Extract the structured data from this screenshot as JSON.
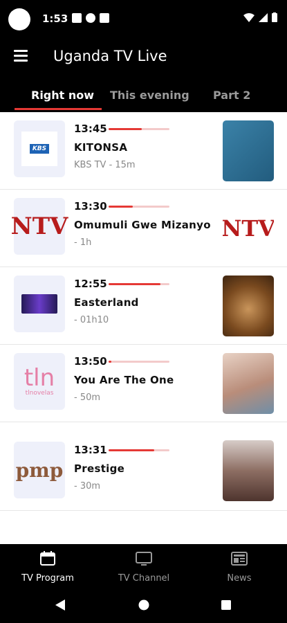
{
  "status": {
    "time": "1:53"
  },
  "app": {
    "title": "Uganda TV Live"
  },
  "tabs": [
    {
      "label": "Right now",
      "active": true
    },
    {
      "label": "This evening",
      "active": false
    },
    {
      "label": "Part 2",
      "active": false
    }
  ],
  "programs": [
    {
      "time": "13:45",
      "title": "KITONSA",
      "subtitle": "KBS TV - 15m",
      "progress": 0.55,
      "channel_logo": "KBS",
      "thumb_color": "#2f6f96"
    },
    {
      "time": "13:30",
      "title": "Omumuli Gwe Mizanyo",
      "subtitle": " - 1h",
      "progress": 0.4,
      "channel_logo": "NTV",
      "thumb_color": "#ffffff"
    },
    {
      "time": "12:55",
      "title": "Easterland",
      "subtitle": " - 01h10",
      "progress": 0.85,
      "channel_logo": "",
      "thumb_color": "#7a4a1f"
    },
    {
      "time": "13:50",
      "title": "You Are The One",
      "subtitle": " - 50m",
      "progress": 0.05,
      "channel_logo": "tln",
      "channel_sub": "tlnovelas",
      "thumb_color": "#c9a394"
    },
    {
      "time": "13:31",
      "title": "Prestige",
      "subtitle": " - 30m",
      "progress": 0.75,
      "channel_logo": "pmp",
      "channel_sub": "",
      "thumb_color": "#8d6e63"
    }
  ],
  "bottom_nav": [
    {
      "label": "TV Program",
      "icon": "calendar-icon",
      "active": true
    },
    {
      "label": "TV Channel",
      "icon": "tv-icon",
      "active": false
    },
    {
      "label": "News",
      "icon": "newspaper-icon",
      "active": false
    }
  ],
  "colors": {
    "accent": "#e53935",
    "background": "#000000"
  }
}
